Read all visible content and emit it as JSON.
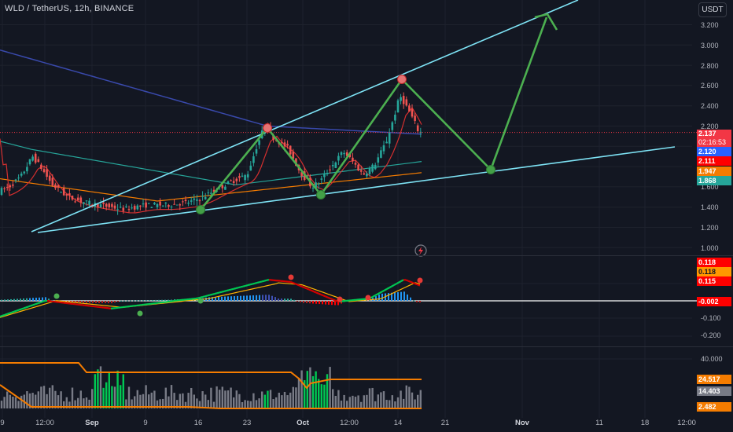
{
  "header": {
    "title": "WLD / TetherUS, 12h, BINANCE",
    "currency": "USDT"
  },
  "price_axis": [
    "3.200",
    "3.000",
    "2.800",
    "2.600",
    "2.400",
    "2.200",
    "1.600",
    "1.400",
    "1.200",
    "1.000"
  ],
  "price_tags": [
    {
      "text": "2.137",
      "sub": "02:16:53",
      "bg": "#f23645",
      "color": "#ffffff"
    },
    {
      "text": "2.120",
      "bg": "#2962ff",
      "color": "#ffffff"
    },
    {
      "text": "2.111",
      "bg": "#ff0000",
      "color": "#ffffff"
    },
    {
      "text": "1.947",
      "bg": "#f57c00",
      "color": "#ffffff"
    },
    {
      "text": "1.868",
      "bg": "#26a69a",
      "color": "#ffffff"
    }
  ],
  "macd_axis": [
    "-0.100",
    "-0.200"
  ],
  "macd_tags": [
    {
      "text": "0.118",
      "bg": "#ff0000",
      "color": "#ffffff"
    },
    {
      "text": "0.118",
      "bg": "#ff9800",
      "color": "#131722"
    },
    {
      "text": "0.115",
      "bg": "#ff0000",
      "color": "#ffffff"
    },
    {
      "text": "-0.002",
      "bg": "#ff0000",
      "color": "#ffffff"
    }
  ],
  "vol_axis": [
    "40.000"
  ],
  "vol_tags": [
    {
      "text": "24.517",
      "bg": "#f57c00",
      "color": "#ffffff"
    },
    {
      "text": "14.403",
      "bg": "#787b86",
      "color": "#ffffff"
    },
    {
      "text": "2.482",
      "bg": "#f57c00",
      "color": "#ffffff"
    }
  ],
  "time_axis": [
    {
      "text": "9",
      "bold": false
    },
    {
      "text": "12:00",
      "bold": false
    },
    {
      "text": "Sep",
      "bold": true
    },
    {
      "text": "9",
      "bold": false
    },
    {
      "text": "16",
      "bold": false
    },
    {
      "text": "23",
      "bold": false
    },
    {
      "text": "Oct",
      "bold": true
    },
    {
      "text": "12:00",
      "bold": false
    },
    {
      "text": "14",
      "bold": false
    },
    {
      "text": "21",
      "bold": false
    },
    {
      "text": "Nov",
      "bold": true
    },
    {
      "text": "11",
      "bold": false
    },
    {
      "text": "18",
      "bold": false
    },
    {
      "text": "12:00",
      "bold": false
    }
  ],
  "colors": {
    "up": "#26a69a",
    "down": "#ef5350",
    "channel": "#7ee3f5",
    "pattern": "#4caf50",
    "ma_blue": "#3949ab",
    "ma_teal": "#26a69a",
    "ma_orange": "#f57c00",
    "ma_red": "#d32f2f",
    "current_price_line": "#f23645"
  },
  "icons": [
    "lightning-icon"
  ]
}
